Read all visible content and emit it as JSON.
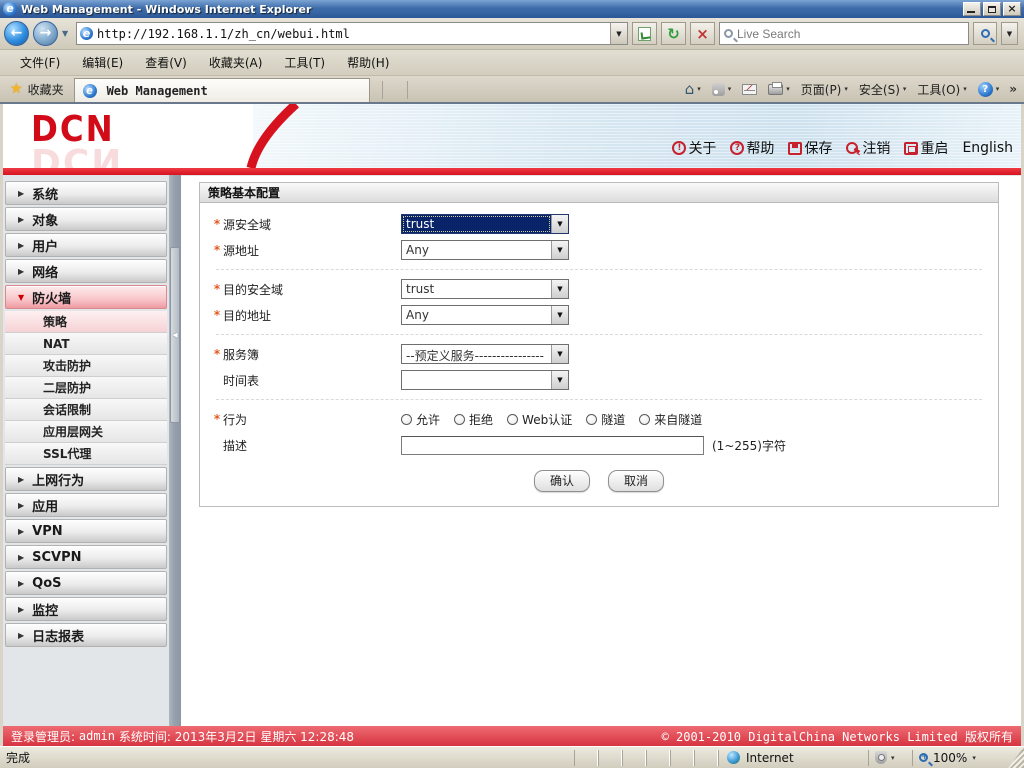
{
  "window": {
    "title": "Web Management - Windows Internet Explorer"
  },
  "address_bar": {
    "url": "http://192.168.1.1/zh_cn/webui.html",
    "search_placeholder": "Live Search"
  },
  "menu_bar": {
    "items": [
      "文件(F)",
      "编辑(E)",
      "查看(V)",
      "收藏夹(A)",
      "工具(T)",
      "帮助(H)"
    ]
  },
  "favorites_bar": {
    "favorites_label": "收藏夹",
    "tab_title": "Web Management",
    "commands": {
      "page": "页面(P)",
      "safety": "安全(S)",
      "tools": "工具(O)"
    }
  },
  "header": {
    "logo": "DCN",
    "links": [
      {
        "label": "关于"
      },
      {
        "label": "帮助"
      },
      {
        "label": "保存"
      },
      {
        "label": "注销"
      },
      {
        "label": "重启"
      },
      {
        "label": "English"
      }
    ]
  },
  "sidebar": {
    "top_items": [
      "系统",
      "对象",
      "用户",
      "网络",
      "防火墙",
      "上网行为",
      "应用",
      "VPN",
      "SCVPN",
      "QoS",
      "监控",
      "日志报表"
    ],
    "sub_items": [
      "策略",
      "NAT",
      "攻击防护",
      "二层防护",
      "会话限制",
      "应用层网关",
      "SSL代理"
    ],
    "selected_sub_item": "策略"
  },
  "form": {
    "title": "策略基本配置",
    "required_mark": "*",
    "fields": {
      "src_zone": {
        "label": "源安全域",
        "value": "trust"
      },
      "src_addr": {
        "label": "源地址",
        "value": "Any"
      },
      "dst_zone": {
        "label": "目的安全域",
        "value": "trust"
      },
      "dst_addr": {
        "label": "目的地址",
        "value": "Any"
      },
      "service": {
        "label": "服务簿",
        "value": "--预定义服务----------------"
      },
      "schedule": {
        "label": "时间表",
        "value": ""
      },
      "action": {
        "label": "行为",
        "options": [
          "允许",
          "拒绝",
          "Web认证",
          "隧道",
          "来自隧道"
        ]
      },
      "description": {
        "label": "描述",
        "value": "",
        "hint": "(1~255)字符"
      }
    },
    "buttons": {
      "ok": "确认",
      "cancel": "取消"
    }
  },
  "app_status_bar": {
    "login_label": "登录管理员:",
    "login_user": "admin",
    "time_label": "系统时间:",
    "time_value": "2013年3月2日 星期六 12:28:48",
    "copyright": "© 2001-2010 DigitalChina Networks Limited 版权所有"
  },
  "ie_status_bar": {
    "status": "完成",
    "zone": "Internet",
    "zoom": "100%"
  },
  "icons": {
    "star": "★",
    "back": "←",
    "forward": "→",
    "refresh": "↻",
    "stop": "×",
    "home": "⌂",
    "dropdown": "▼",
    "small_down": "▾",
    "overflow": "»",
    "collapsed_arrow": "▶",
    "expanded_arrow": "▼",
    "splitter_arrow": "◀",
    "close": "×",
    "about_glyph": "!",
    "help_glyph": "?"
  }
}
